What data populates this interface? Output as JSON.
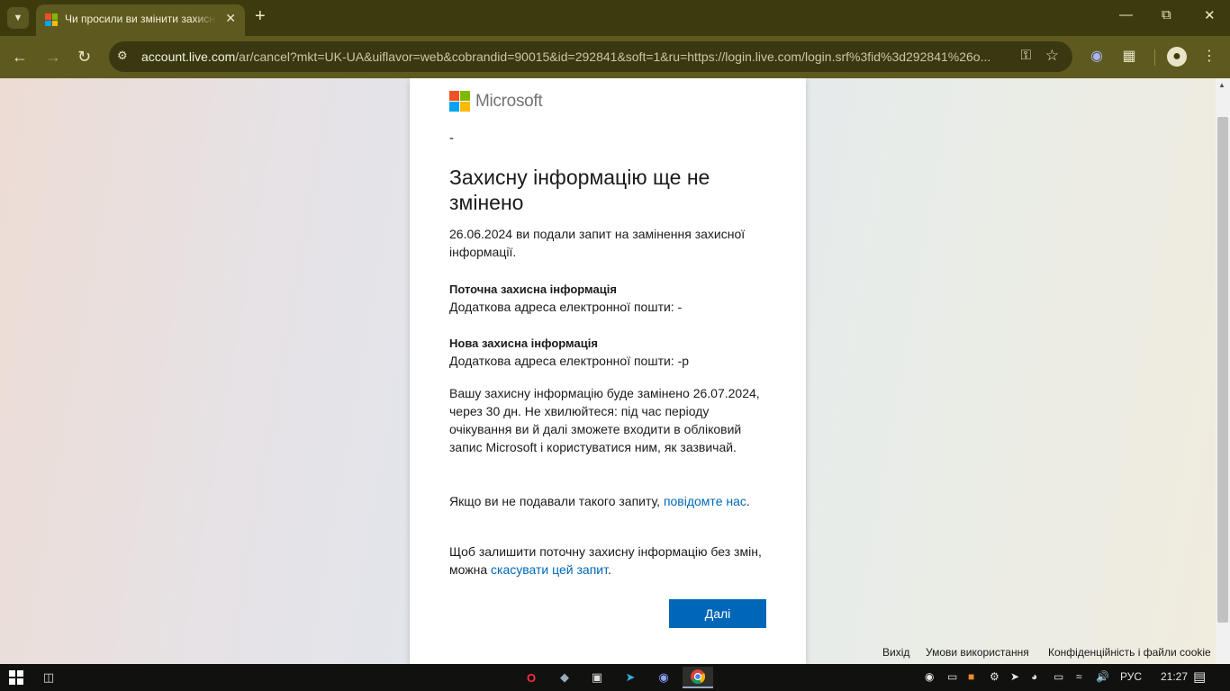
{
  "browser": {
    "tab_title": "Чи просили ви змінити захисну інформацію?",
    "url_host": "account.live.com",
    "url_rest": "/ar/cancel?mkt=UK-UA&uiflavor=web&cobrandid=90015&id=292841&soft=1&ru=https://login.live.com/login.srf%3fid%3d292841%26o..."
  },
  "page": {
    "logo_text": "Microsoft",
    "dash": "-",
    "title": "Захисну інформацію ще не змінено",
    "request_text": "26.06.2024 ви подали запит на замінення захисної інформації.",
    "current_label": "Поточна захисна інформація",
    "current_value": "Додаткова адреса електронної пошти: -",
    "new_label": "Нова захисна інформація",
    "new_value": "Додаткова адреса електронної пошти: -р",
    "wait_text": "Вашу захисну інформацію буде замінено 26.07.2024, через 30 дн. Не хвилюйтеся: під час періоду очікування ви й далі зможете входити в обліковий запис Microsoft і користуватися ним, як зазвичай.",
    "report_prefix": "Якщо ви не подавали такого запиту, ",
    "report_link": "повідомте нас",
    "report_suffix": ".",
    "cancel_prefix": "Щоб залишити поточну захисну інформацію без змін, можна ",
    "cancel_link": "скасувати цей запит",
    "cancel_suffix": ".",
    "next_button": "Далі",
    "footer": {
      "exit": "Вихід",
      "terms": "Умови використання",
      "privacy": "Конфіденційність і файли cookie"
    }
  },
  "taskbar": {
    "language": "РУС",
    "time": "21:27"
  },
  "colors": {
    "chrome_dark": "#3d3b0e",
    "chrome_toolbar": "#5e5a1f",
    "ms_blue": "#0067b8",
    "logo_red": "#f25022",
    "logo_green": "#7fba00",
    "logo_blue": "#00a4ef",
    "logo_yellow": "#ffb900"
  }
}
